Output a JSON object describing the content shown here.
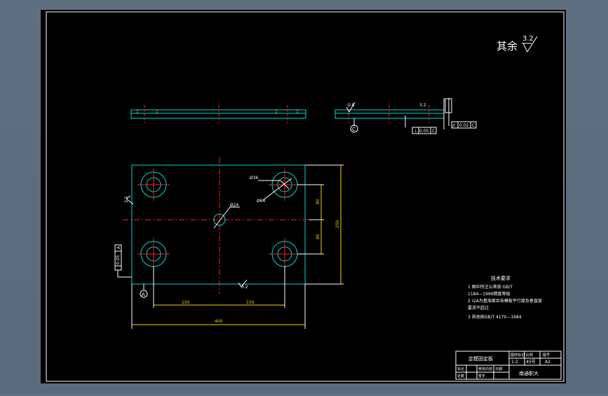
{
  "roughness_note": {
    "label": "其余",
    "value": "3.2"
  },
  "title_block": {
    "part_name": "定模固定板",
    "company": "南通职大",
    "size": "A2",
    "scale": "1:2",
    "sheet": "45号",
    "headers": [
      "图样标记",
      "比例",
      "图号"
    ],
    "row_labels": [
      "标记",
      "处数",
      "修改内容",
      "签字",
      "日期"
    ]
  },
  "tech_requirements": {
    "title": "技术要求",
    "lines": [
      "1 图中所注公差按 GB/T",
      "1184—1996精度等级",
      "2 以A为基准面且各模板平行度及垂直度",
      "要求不超过",
      "3 其他按GB/T 4170—1984"
    ]
  },
  "dimensions": {
    "hole_large": "Ø36",
    "hole_small": "Ø64",
    "center_hole": "Ø24",
    "vertical_upper": "80",
    "vertical_lower": "80",
    "height_total": "250",
    "horizontal_left": "150",
    "horizontal_right": "150",
    "width_total": "400"
  },
  "datums": {
    "a": "A",
    "c": "C",
    "tol_flat": "0.05",
    "tol_parallel": "0.02",
    "tol_perp": "0.05",
    "rough_small": "0.8",
    "rough_side": "3.2",
    "rough_bottom": "3.2"
  }
}
